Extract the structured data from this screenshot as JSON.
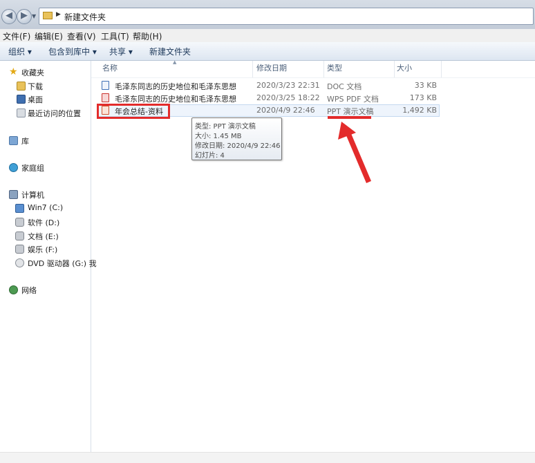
{
  "address": {
    "path": "新建文件夹"
  },
  "menubar": [
    "文件(F)",
    "编辑(E)",
    "查看(V)",
    "工具(T)",
    "帮助(H)"
  ],
  "toolbar": {
    "organize": "组织 ▾",
    "include_library": "包含到库中 ▾",
    "share": "共享 ▾",
    "new_folder": "新建文件夹"
  },
  "nav": {
    "favorites": "收藏夹",
    "downloads": "下载",
    "desktop": "桌面",
    "recent": "最近访问的位置",
    "libraries": "库",
    "homegroup": "家庭组",
    "computer": "计算机",
    "drives": [
      "Win7 (C:)",
      "软件 (D:)",
      "文档 (E:)",
      "娱乐 (F:)",
      "DVD 驱动器 (G:) 我"
    ],
    "network": "网络"
  },
  "columns": {
    "name": "名称",
    "date": "修改日期",
    "type": "类型",
    "size": "大小"
  },
  "files": [
    {
      "name": "毛泽东同志的历史地位和毛泽东思想",
      "date": "2020/3/23 22:31",
      "type": "DOC 文档",
      "size": "33 KB",
      "icon": "doc-file-icon"
    },
    {
      "name": "毛泽东同志的历史地位和毛泽东思想",
      "date": "2020/3/25 18:22",
      "type": "WPS PDF 文档",
      "size": "173 KB",
      "icon": "pdf-file-icon"
    },
    {
      "name": "年会总结-资料",
      "date": "2020/4/9 22:46",
      "type": "PPT 演示文稿",
      "size": "1,492 KB",
      "icon": "ppt-file-icon"
    }
  ],
  "tooltip": {
    "type": "类型: PPT 演示文稿",
    "size": "大小: 1.45 MB",
    "modified": "修改日期: 2020/4/9 22:46",
    "slides": "幻灯片: 4"
  },
  "colors": {
    "highlight": "#e32b2b",
    "hover_row": "#eef4fc",
    "nav_border": "#d7dfe8"
  }
}
